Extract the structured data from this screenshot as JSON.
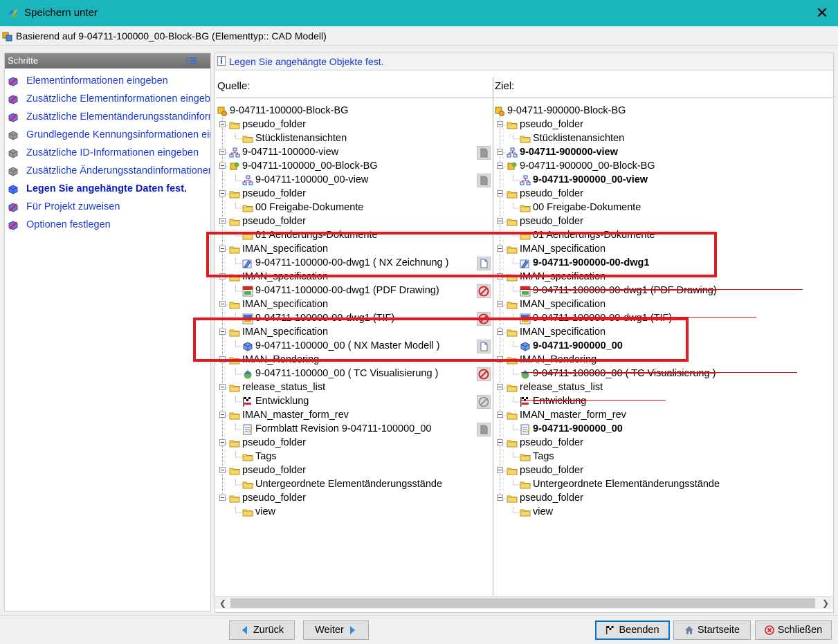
{
  "window": {
    "title": "Speichern unter",
    "close_glyph": "✕"
  },
  "info": {
    "text": "Basierend auf 9-04711-100000_00-Block-BG (Elementtyp:: CAD Modell)"
  },
  "steps": {
    "title": "Schritte",
    "items": [
      {
        "label": "Elementinformationen eingeben",
        "icon": "step-done-icon"
      },
      {
        "label": "Zusätzliche Elementinformationen eingeben",
        "icon": "step-done-icon"
      },
      {
        "label": "Zusätzliche Elementänderungsstandinformationen",
        "icon": "step-done-icon"
      },
      {
        "label": "Grundlegende Kennungsinformationen eingeben",
        "icon": "step-disabled-icon"
      },
      {
        "label": "Zusätzliche ID-Informationen eingeben",
        "icon": "step-disabled-icon"
      },
      {
        "label": "Zusätzliche Änderungsstandinformationen eingeben",
        "icon": "step-disabled-icon"
      },
      {
        "label": "Legen Sie angehängte Daten fest.",
        "icon": "step-current-icon"
      },
      {
        "label": "Für Projekt zuweisen",
        "icon": "step-done-icon"
      },
      {
        "label": "Optionen festlegen",
        "icon": "step-done-icon"
      }
    ]
  },
  "instruction": "Legen Sie angehängte Objekte fest.",
  "source": {
    "header": "Quelle:",
    "rows": [
      {
        "label": "9-04711-100000-Block-BG",
        "level": 0,
        "icon": "item-icon"
      },
      {
        "label": "pseudo_folder",
        "level": 1,
        "icon": "folder-icon"
      },
      {
        "label": "Stücklistenansichten",
        "level": 2,
        "icon": "folder-icon"
      },
      {
        "label": "9-04711-100000-view",
        "level": 1,
        "icon": "bom-view-icon",
        "action": "copy-icon"
      },
      {
        "label": "9-04711-100000_00-Block-BG",
        "level": 1,
        "icon": "item-revision-icon"
      },
      {
        "label": "9-04711-100000_00-view",
        "level": 2,
        "icon": "bom-view-icon",
        "action": "copy-icon"
      },
      {
        "label": "pseudo_folder",
        "level": 1,
        "icon": "folder-icon"
      },
      {
        "label": "00 Freigabe-Dokumente",
        "level": 2,
        "icon": "folder-icon"
      },
      {
        "label": "pseudo_folder",
        "level": 1,
        "icon": "folder-icon"
      },
      {
        "label": "01 Aenderungs-Dokumente",
        "level": 2,
        "icon": "folder-icon"
      },
      {
        "label": "IMAN_specification",
        "level": 1,
        "icon": "folder-icon"
      },
      {
        "label": "9-04711-100000-00-dwg1  ( NX Zeichnung )",
        "level": 2,
        "icon": "nx-drawing-icon",
        "action": "new-icon"
      },
      {
        "label": "IMAN_specification",
        "level": 1,
        "icon": "folder-icon"
      },
      {
        "label": "9-04711-100000-00-dwg1  (PDF Drawing)",
        "level": 2,
        "icon": "pdf-icon",
        "action": "no-copy-icon"
      },
      {
        "label": "IMAN_specification",
        "level": 1,
        "icon": "folder-icon"
      },
      {
        "label": "9-04711-100000-00-dwg1  (TIF)",
        "level": 2,
        "icon": "tif-icon",
        "action": "no-copy-icon"
      },
      {
        "label": "IMAN_specification",
        "level": 1,
        "icon": "folder-icon"
      },
      {
        "label": "9-04711-100000_00  ( NX Master Modell )",
        "level": 2,
        "icon": "nx-model-icon",
        "action": "new-icon"
      },
      {
        "label": "IMAN_Rendering",
        "level": 1,
        "icon": "folder-icon"
      },
      {
        "label": "9-04711-100000_00  ( TC Visualisierung )",
        "level": 2,
        "icon": "visualization-icon",
        "action": "no-copy-icon"
      },
      {
        "label": "release_status_list",
        "level": 1,
        "icon": "folder-icon"
      },
      {
        "label": "Entwicklung",
        "level": 2,
        "icon": "status-flag-icon",
        "action": "disabled-icon"
      },
      {
        "label": "IMAN_master_form_rev",
        "level": 1,
        "icon": "folder-icon"
      },
      {
        "label": "Formblatt Revision 9-04711-100000_00",
        "level": 2,
        "icon": "form-icon",
        "action": "copy-icon"
      },
      {
        "label": "pseudo_folder",
        "level": 1,
        "icon": "folder-icon"
      },
      {
        "label": "Tags",
        "level": 2,
        "icon": "folder-icon"
      },
      {
        "label": "pseudo_folder",
        "level": 1,
        "icon": "folder-icon"
      },
      {
        "label": "Untergeordnete Elementänderungsstände",
        "level": 2,
        "icon": "folder-icon"
      },
      {
        "label": "pseudo_folder",
        "level": 1,
        "icon": "folder-icon"
      },
      {
        "label": "view",
        "level": 2,
        "icon": "folder-icon"
      }
    ]
  },
  "target": {
    "header": "Ziel:",
    "rows": [
      {
        "label": "9-04711-900000-Block-BG",
        "level": 0,
        "icon": "item-icon"
      },
      {
        "label": "pseudo_folder",
        "level": 1,
        "icon": "folder-icon"
      },
      {
        "label": "Stücklistenansichten",
        "level": 2,
        "icon": "folder-icon"
      },
      {
        "label": "9-04711-900000-view",
        "level": 1,
        "icon": "bom-view-icon",
        "style": "bold"
      },
      {
        "label": "9-04711-900000_00-Block-BG",
        "level": 1,
        "icon": "item-revision-icon"
      },
      {
        "label": "9-04711-900000_00-view",
        "level": 2,
        "icon": "bom-view-icon",
        "style": "bold"
      },
      {
        "label": "pseudo_folder",
        "level": 1,
        "icon": "folder-icon"
      },
      {
        "label": "00 Freigabe-Dokumente",
        "level": 2,
        "icon": "folder-icon"
      },
      {
        "label": "pseudo_folder",
        "level": 1,
        "icon": "folder-icon"
      },
      {
        "label": "01 Aenderungs-Dokumente",
        "level": 2,
        "icon": "folder-icon"
      },
      {
        "label": "IMAN_specification",
        "level": 1,
        "icon": "folder-icon"
      },
      {
        "label": "9-04711-900000-00-dwg1",
        "level": 2,
        "icon": "nx-drawing-icon",
        "style": "bold"
      },
      {
        "label": "IMAN_specification",
        "level": 1,
        "icon": "folder-icon"
      },
      {
        "label": "9-04711-100000-00-dwg1  (PDF Drawing)",
        "level": 2,
        "icon": "pdf-icon",
        "style": "strike"
      },
      {
        "label": "IMAN_specification",
        "level": 1,
        "icon": "folder-icon"
      },
      {
        "label": "9-04711-100000-00-dwg1  (TIF)",
        "level": 2,
        "icon": "tif-icon",
        "style": "strike"
      },
      {
        "label": "IMAN_specification",
        "level": 1,
        "icon": "folder-icon"
      },
      {
        "label": "9-04711-900000_00",
        "level": 2,
        "icon": "nx-model-icon",
        "style": "bold"
      },
      {
        "label": "IMAN_Rendering",
        "level": 1,
        "icon": "folder-icon"
      },
      {
        "label": "9-04711-100000_00  ( TC Visualisierung )",
        "level": 2,
        "icon": "visualization-icon",
        "style": "strike"
      },
      {
        "label": "release_status_list",
        "level": 1,
        "icon": "folder-icon"
      },
      {
        "label": "Entwicklung",
        "level": 2,
        "icon": "status-flag-icon",
        "style": "strike"
      },
      {
        "label": "IMAN_master_form_rev",
        "level": 1,
        "icon": "folder-icon"
      },
      {
        "label": "9-04711-900000_00",
        "level": 2,
        "icon": "form-icon",
        "style": "bold"
      },
      {
        "label": "pseudo_folder",
        "level": 1,
        "icon": "folder-icon"
      },
      {
        "label": "Tags",
        "level": 2,
        "icon": "folder-icon"
      },
      {
        "label": "pseudo_folder",
        "level": 1,
        "icon": "folder-icon"
      },
      {
        "label": "Untergeordnete Elementänderungsstände",
        "level": 2,
        "icon": "folder-icon"
      },
      {
        "label": "pseudo_folder",
        "level": 1,
        "icon": "folder-icon"
      },
      {
        "label": "view",
        "level": 2,
        "icon": "folder-icon"
      }
    ]
  },
  "buttons": {
    "back": "Zurück",
    "next": "Weiter",
    "finish": "Beenden",
    "home": "Startseite",
    "close": "Schließen"
  },
  "colors": {
    "titlebar": "#1bb5bd",
    "link": "#1a3ad6",
    "highlight": "#e11b22",
    "strike": "#e01010",
    "focus": "#0078d7"
  }
}
